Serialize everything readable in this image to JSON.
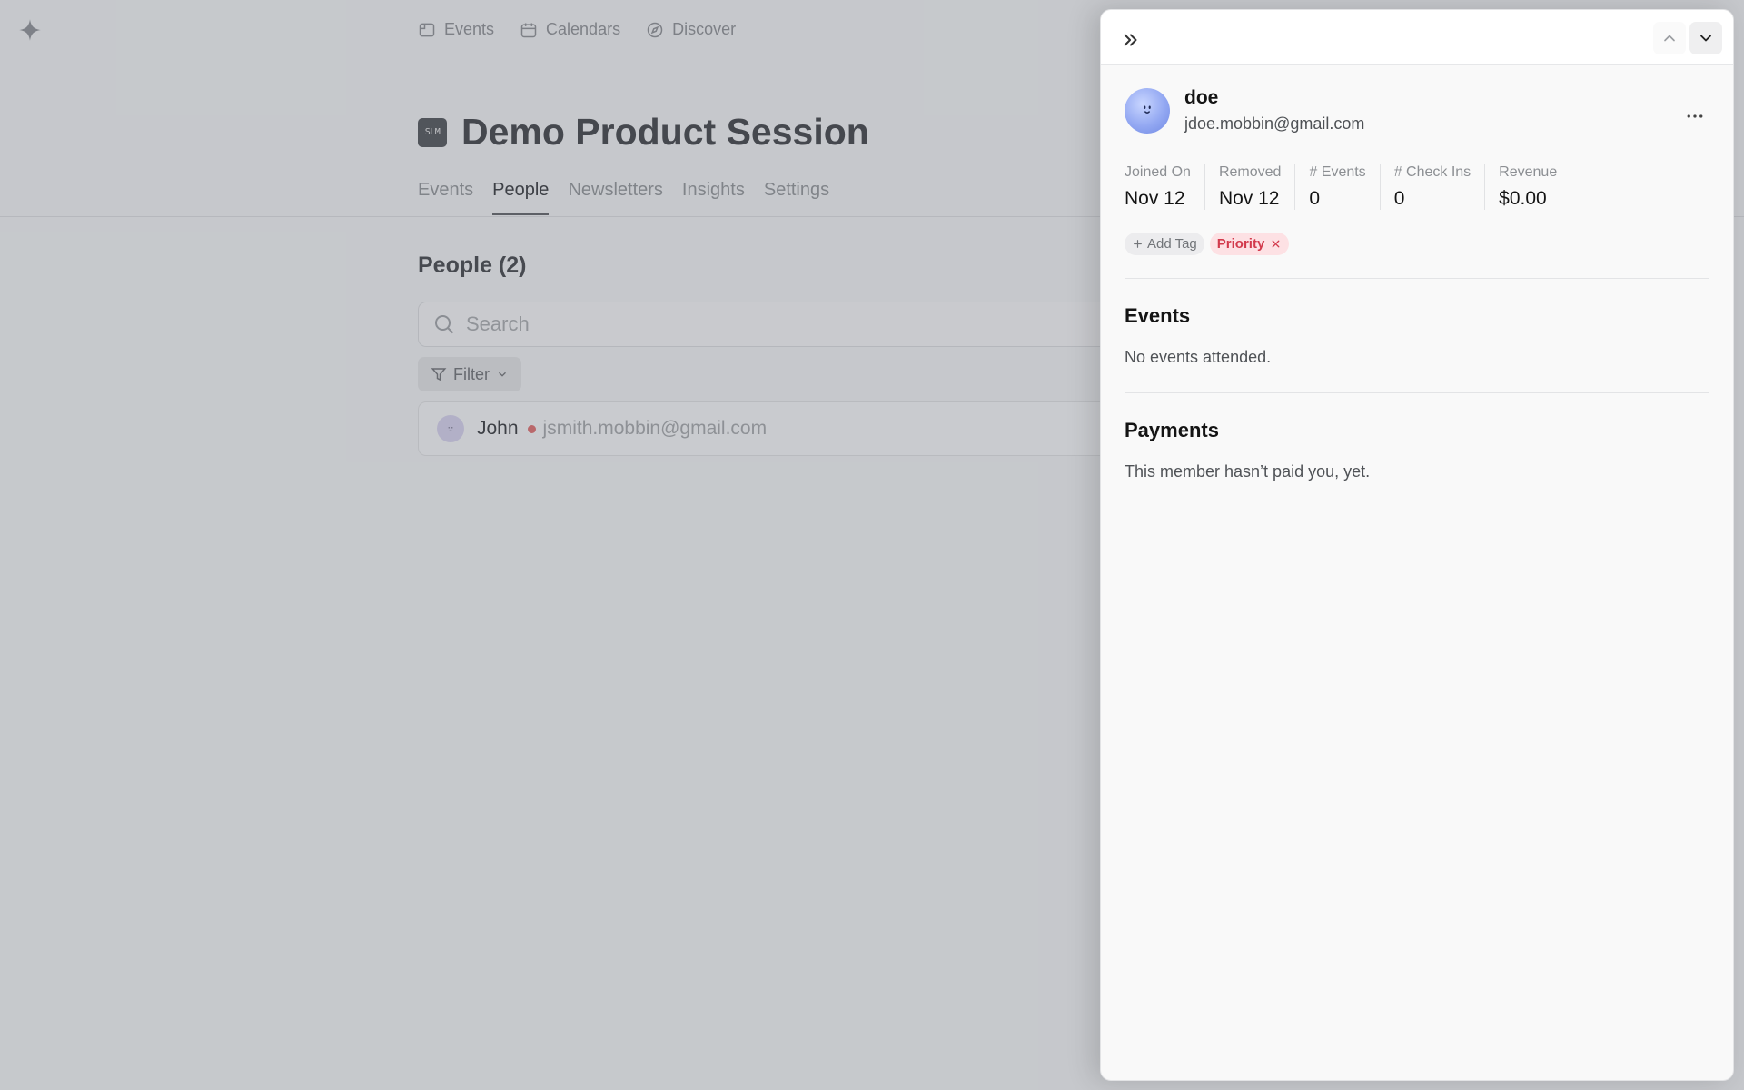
{
  "topnav": {
    "items": [
      {
        "label": "Events"
      },
      {
        "label": "Calendars"
      },
      {
        "label": "Discover"
      }
    ]
  },
  "calendar": {
    "logo_text": "SLM",
    "title": "Demo Product Session",
    "tabs": [
      {
        "label": "Events"
      },
      {
        "label": "People",
        "active": true
      },
      {
        "label": "Newsletters"
      },
      {
        "label": "Insights"
      },
      {
        "label": "Settings"
      }
    ]
  },
  "people": {
    "heading": "People (2)",
    "search_placeholder": "Search",
    "filter_label": "Filter",
    "rows": [
      {
        "name": "John",
        "email": "jsmith.mobbin@gmail.com"
      }
    ]
  },
  "panel": {
    "member": {
      "name": "doe",
      "email": "jdoe.mobbin@gmail.com"
    },
    "stats": [
      {
        "label": "Joined On",
        "value": "Nov 12"
      },
      {
        "label": "Removed",
        "value": "Nov 12"
      },
      {
        "label": "# Events",
        "value": "0"
      },
      {
        "label": "# Check Ins",
        "value": "0"
      },
      {
        "label": "Revenue",
        "value": "$0.00"
      }
    ],
    "tags": {
      "add_label": "Add Tag",
      "items": [
        {
          "label": "Priority",
          "color": "#d23a4c"
        }
      ]
    },
    "events": {
      "title": "Events",
      "empty_text": "No events attended."
    },
    "payments": {
      "title": "Payments",
      "empty_text": "This member hasn’t paid you, yet."
    }
  },
  "colors": {
    "accent_tag_bg": "#fde1e4",
    "accent_tag_text": "#d23a4c",
    "status_dot": "#e06a6a"
  }
}
